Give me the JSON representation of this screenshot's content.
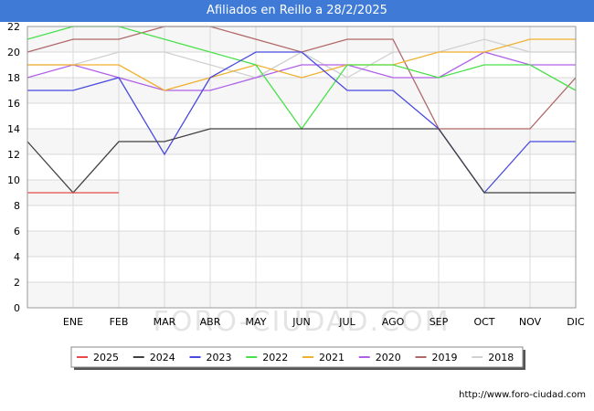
{
  "title": "Afiliados en Reillo a 28/2/2025",
  "source": "http://www.foro-ciudad.com",
  "watermark": "FORO-CIUDAD.COM",
  "chart_data": {
    "type": "line",
    "title": "Afiliados en Reillo a 28/2/2025",
    "xlabel": "",
    "ylabel": "",
    "categories": [
      "",
      "ENE",
      "FEB",
      "MAR",
      "ABR",
      "MAY",
      "JUN",
      "JUL",
      "AGO",
      "SEP",
      "OCT",
      "NOV",
      "DIC"
    ],
    "ylim": [
      0,
      22
    ],
    "yticks": [
      0,
      2,
      4,
      6,
      8,
      10,
      12,
      14,
      16,
      18,
      20,
      22
    ],
    "grid": true,
    "legend_position": "bottom",
    "series": [
      {
        "name": "2025",
        "color": "#e84a4a",
        "values": [
          9,
          9,
          9
        ]
      },
      {
        "name": "2024",
        "color": "#404040",
        "values": [
          13,
          9,
          13,
          13,
          14,
          14,
          14,
          14,
          14,
          14,
          9,
          9,
          9
        ]
      },
      {
        "name": "2023",
        "color": "#4a4ae0",
        "values": [
          17,
          17,
          18,
          12,
          18,
          20,
          20,
          17,
          17,
          14,
          9,
          13,
          13
        ]
      },
      {
        "name": "2022",
        "color": "#4ae04a",
        "values": [
          21,
          22,
          22,
          21,
          20,
          19,
          14,
          19,
          19,
          18,
          19,
          19,
          17
        ]
      },
      {
        "name": "2021",
        "color": "#f0b030",
        "values": [
          19,
          19,
          19,
          17,
          18,
          19,
          18,
          19,
          19,
          20,
          20,
          21,
          21
        ]
      },
      {
        "name": "2020",
        "color": "#b060e8",
        "values": [
          18,
          19,
          18,
          17,
          17,
          18,
          19,
          19,
          18,
          18,
          20,
          19,
          19
        ]
      },
      {
        "name": "2019",
        "color": "#b06868",
        "values": [
          20,
          21,
          21,
          22,
          22,
          21,
          20,
          21,
          21,
          14,
          14,
          14,
          18
        ]
      },
      {
        "name": "2018",
        "color": "#d0d0d0",
        "values": [
          19,
          19,
          20,
          20,
          19,
          18,
          20,
          18,
          20,
          20,
          21,
          20,
          20
        ]
      }
    ]
  }
}
